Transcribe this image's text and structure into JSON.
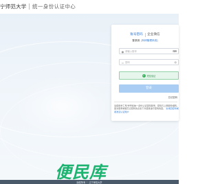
{
  "header": {
    "logo_text": "宁师范大学",
    "system_title": "统一身份认证中心"
  },
  "card": {
    "tabs": [
      {
        "label": "账号密码",
        "active": true
      },
      {
        "label": "企业微信",
        "active": false
      }
    ],
    "login_hint": {
      "text": "登录到",
      "link": "[科研管理系统]"
    },
    "username_placeholder": "请输入账号",
    "password_placeholder": "密码",
    "sms_button_label": "短信验证",
    "submit_label": "登录",
    "forgot_label": "忘记密码",
    "notice": {
      "text": "请使用学工号/学号和统一身份认证密码登录，密码与上网服务相同。首次登录或者忘记密码请点击下方链接进行密码找回。",
      "link": "去找回密码或者激活认证账户"
    }
  },
  "watermark": "便民库",
  "footer": {
    "items": [
      "版权所有",
      "辽宁师范大学"
    ]
  },
  "colors": {
    "accent": "#2f7bd6",
    "submit_bg": "#a9cdf3",
    "sms_bg": "#e7f6ec",
    "footer_bg": "#4a5a6b",
    "watermark": "#1bb36f"
  }
}
